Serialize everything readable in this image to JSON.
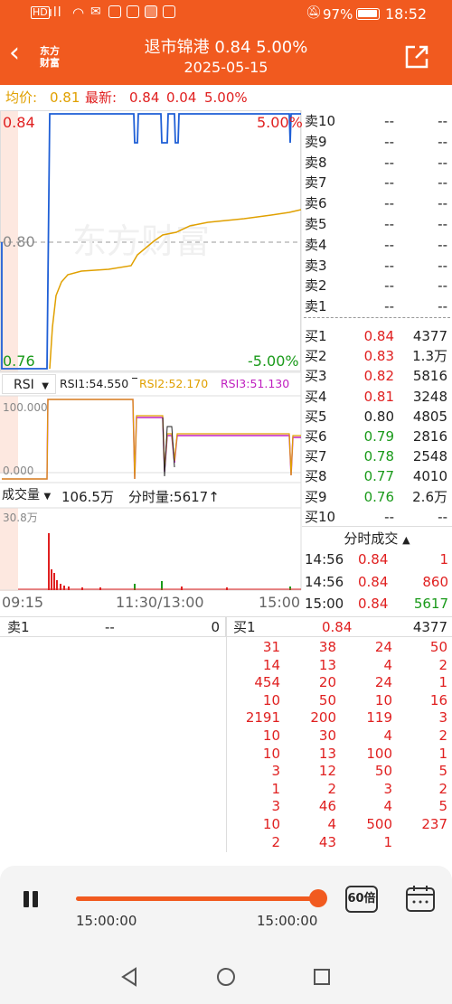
{
  "status_bar": {
    "left_icons": [
      "hd-icon",
      "signal-icon",
      "wifi-icon",
      "notif-icon",
      "app-icon",
      "app-icon",
      "app-icon"
    ],
    "battery": "97%",
    "time": "18:52"
  },
  "header": {
    "logo_line1": "东方",
    "logo_line2": "财富",
    "title": "退市锦港  0.84  5.00%",
    "date": "2025-05-15"
  },
  "price_bar": {
    "avg_label": "均价:",
    "avg_value": "0.81",
    "latest_label": "最新:",
    "latest_value": "0.84",
    "change": "0.04",
    "pct": "5.00%"
  },
  "chart": {
    "price_high": "0.84",
    "price_mid": "0.80",
    "price_low": "0.76",
    "pct_high": "5.00%",
    "pct_low": "-5.00%",
    "watermark": "东方财富",
    "rsi_label": "RSI",
    "rsi1": "RSI1:54.550",
    "rsi2": "RSI2:52.170",
    "rsi3": "RSI3:51.130",
    "rsi_top": "100.000",
    "rsi_bot": "0.000",
    "vol_label": "成交量",
    "vol_value": "106.5万",
    "vol_fen": "分时量:5617",
    "vol_max": "30.8万",
    "time_start": "09:15",
    "time_mid": "11:30/13:00",
    "time_end": "15:00",
    "colors": {
      "price": "#1f5fd6",
      "avg": "#e0a000",
      "rsi1": "#222222",
      "rsi2": "#e0a000",
      "rsi3": "#c020c0",
      "vol_up": "#e02020",
      "vol_down": "#1a9a1a"
    }
  },
  "orderbook": {
    "asks": [
      {
        "label": "卖10",
        "price": "--",
        "vol": "--"
      },
      {
        "label": "卖9",
        "price": "--",
        "vol": "--"
      },
      {
        "label": "卖8",
        "price": "--",
        "vol": "--"
      },
      {
        "label": "卖7",
        "price": "--",
        "vol": "--"
      },
      {
        "label": "卖6",
        "price": "--",
        "vol": "--"
      },
      {
        "label": "卖5",
        "price": "--",
        "vol": "--"
      },
      {
        "label": "卖4",
        "price": "--",
        "vol": "--"
      },
      {
        "label": "卖3",
        "price": "--",
        "vol": "--"
      },
      {
        "label": "卖2",
        "price": "--",
        "vol": "--"
      },
      {
        "label": "卖1",
        "price": "--",
        "vol": "--"
      }
    ],
    "bids": [
      {
        "label": "买1",
        "price": "0.84",
        "vol": "4377",
        "cls": "red"
      },
      {
        "label": "买2",
        "price": "0.83",
        "vol": "1.3万",
        "cls": "red"
      },
      {
        "label": "买3",
        "price": "0.82",
        "vol": "5816",
        "cls": "red"
      },
      {
        "label": "买4",
        "price": "0.81",
        "vol": "3248",
        "cls": "red"
      },
      {
        "label": "买5",
        "price": "0.80",
        "vol": "4805",
        "cls": "black"
      },
      {
        "label": "买6",
        "price": "0.79",
        "vol": "2816",
        "cls": "green"
      },
      {
        "label": "买7",
        "price": "0.78",
        "vol": "2548",
        "cls": "green"
      },
      {
        "label": "买8",
        "price": "0.77",
        "vol": "4010",
        "cls": "green"
      },
      {
        "label": "买9",
        "price": "0.76",
        "vol": "2.6万",
        "cls": "green"
      },
      {
        "label": "买10",
        "price": "--",
        "vol": "--",
        "cls": "black"
      }
    ],
    "ticks_title": "分时成交",
    "ticks": [
      {
        "time": "14:56",
        "price": "0.84",
        "vol": "1",
        "vcls": "red"
      },
      {
        "time": "14:56",
        "price": "0.84",
        "vol": "860",
        "vcls": "red"
      },
      {
        "time": "15:00",
        "price": "0.84",
        "vol": "5617",
        "vcls": "green"
      }
    ]
  },
  "queue": {
    "sell_label": "卖1",
    "sell_price": "--",
    "sell_count": "0",
    "buy_label": "买1",
    "buy_price": "0.84",
    "buy_total": "4377",
    "rows": [
      [
        "31",
        "38",
        "24",
        "50"
      ],
      [
        "14",
        "13",
        "4",
        "2"
      ],
      [
        "454",
        "20",
        "24",
        "1"
      ],
      [
        "10",
        "50",
        "10",
        "16"
      ],
      [
        "2191",
        "200",
        "119",
        "3"
      ],
      [
        "10",
        "30",
        "4",
        "2"
      ],
      [
        "10",
        "13",
        "100",
        "1"
      ],
      [
        "3",
        "12",
        "50",
        "5"
      ],
      [
        "1",
        "2",
        "3",
        "2"
      ],
      [
        "3",
        "46",
        "4",
        "5"
      ],
      [
        "10",
        "4",
        "500",
        "237"
      ],
      [
        "2",
        "43",
        "1",
        ""
      ]
    ]
  },
  "player": {
    "time_left": "15:00:00",
    "time_right": "15:00:00",
    "speed": "60倍",
    "progress": 1.0
  }
}
